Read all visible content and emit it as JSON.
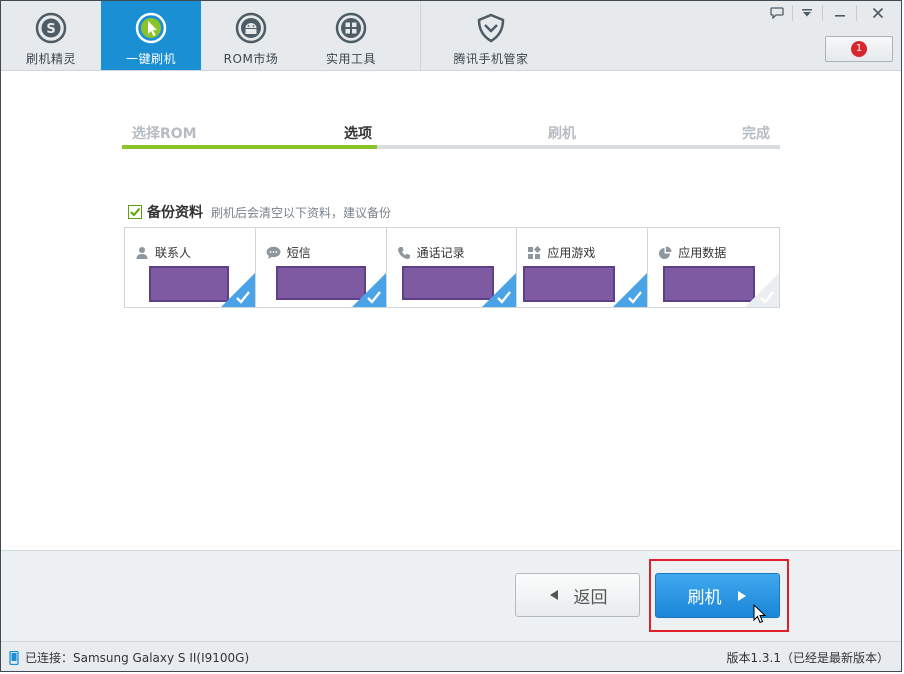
{
  "nav": {
    "items": [
      {
        "label": "刷机精灵",
        "icon": "s-logo-icon"
      },
      {
        "label": "一键刷机",
        "icon": "cursor-arrow-icon"
      },
      {
        "label": "ROM市场",
        "icon": "android-icon"
      },
      {
        "label": "实用工具",
        "icon": "grid-tools-icon"
      },
      {
        "label": "腾讯手机管家",
        "icon": "shield-icon"
      }
    ]
  },
  "notice": {
    "count": "1"
  },
  "steps": {
    "items": [
      "选择ROM",
      "选项",
      "刷机",
      "完成"
    ],
    "current": "选项"
  },
  "backup": {
    "title": "备份资料",
    "hint": "刷机后会清空以下资料，建议备份",
    "items": [
      {
        "label": "联系人",
        "icon": "person-icon",
        "checked": true
      },
      {
        "label": "短信",
        "icon": "chat-bubble-icon",
        "checked": true
      },
      {
        "label": "通话记录",
        "icon": "phone-icon",
        "checked": true
      },
      {
        "label": "应用游戏",
        "icon": "apps-grid-icon",
        "checked": true
      },
      {
        "label": "应用数据",
        "icon": "pie-chart-icon",
        "checked": false
      }
    ]
  },
  "actions": {
    "back_label": "返回",
    "flash_label": "刷机"
  },
  "status": {
    "connected": "已连接：Samsung Galaxy S II(I9100G)",
    "version": "版本1.3.1（已经是最新版本）"
  },
  "colors": {
    "accent": "#1a8fd3",
    "progress": "#8bc429",
    "checked_corner": "#4aa3e6"
  }
}
